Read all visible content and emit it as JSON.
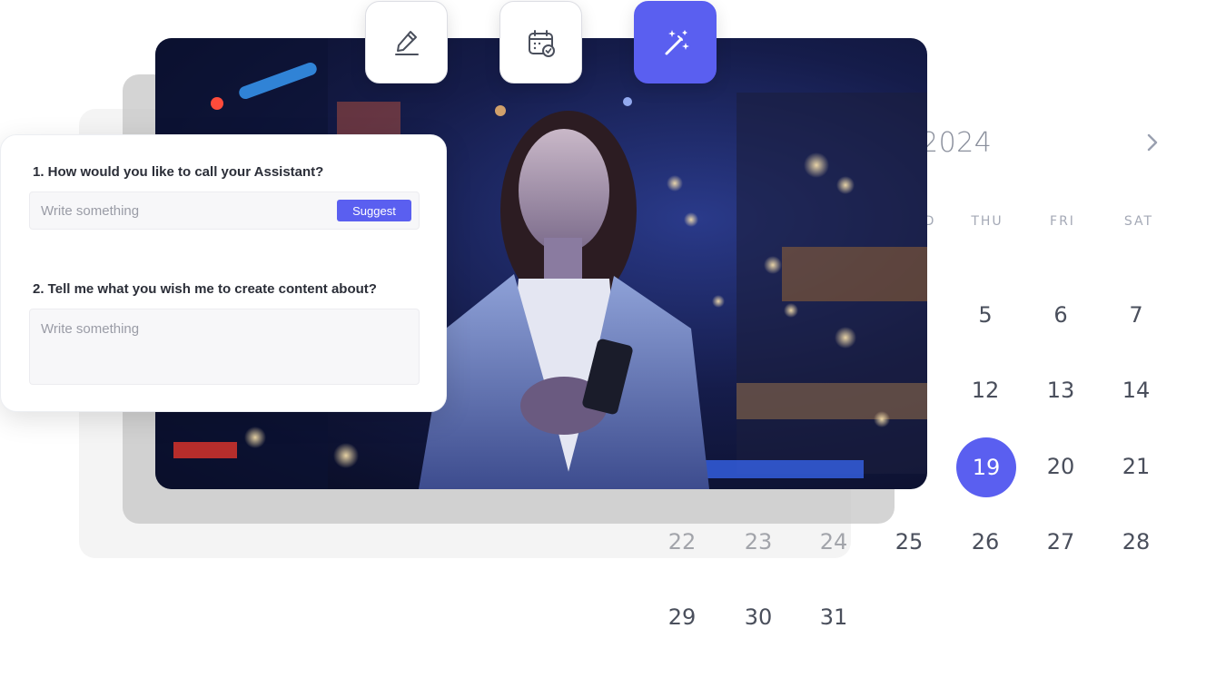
{
  "toolbar": {
    "buttons": [
      {
        "icon": "pencil-icon",
        "active": false
      },
      {
        "icon": "calendar-check-icon",
        "active": false
      },
      {
        "icon": "magic-wand-icon",
        "active": true
      }
    ]
  },
  "form": {
    "question1_label": "1. How would you like to call your Assistant?",
    "question1_placeholder": "Write something",
    "suggest_label": "Suggest",
    "question2_label": "2. Tell me what you wish me to create content about?",
    "question2_placeholder": "Write something"
  },
  "calendar": {
    "month_year": "2024",
    "weekday_partial": "D",
    "weekdays": [
      "THU",
      "FRI",
      "SAT"
    ],
    "visible_days": [
      [
        "",
        "",
        "",
        "",
        "5",
        "6",
        "7"
      ],
      [
        "",
        "",
        "",
        "",
        "12",
        "13",
        "14"
      ],
      [
        "",
        "",
        "",
        "",
        "19",
        "20",
        "21"
      ],
      [
        "22",
        "23",
        "24",
        "25",
        "26",
        "27",
        "28"
      ],
      [
        "29",
        "30",
        "31",
        "",
        "",
        "",
        ""
      ]
    ],
    "selected_day": "19"
  },
  "colors": {
    "accent": "#5a5ff0",
    "text_dark": "#2b2e38",
    "muted": "#9a9ca6"
  }
}
